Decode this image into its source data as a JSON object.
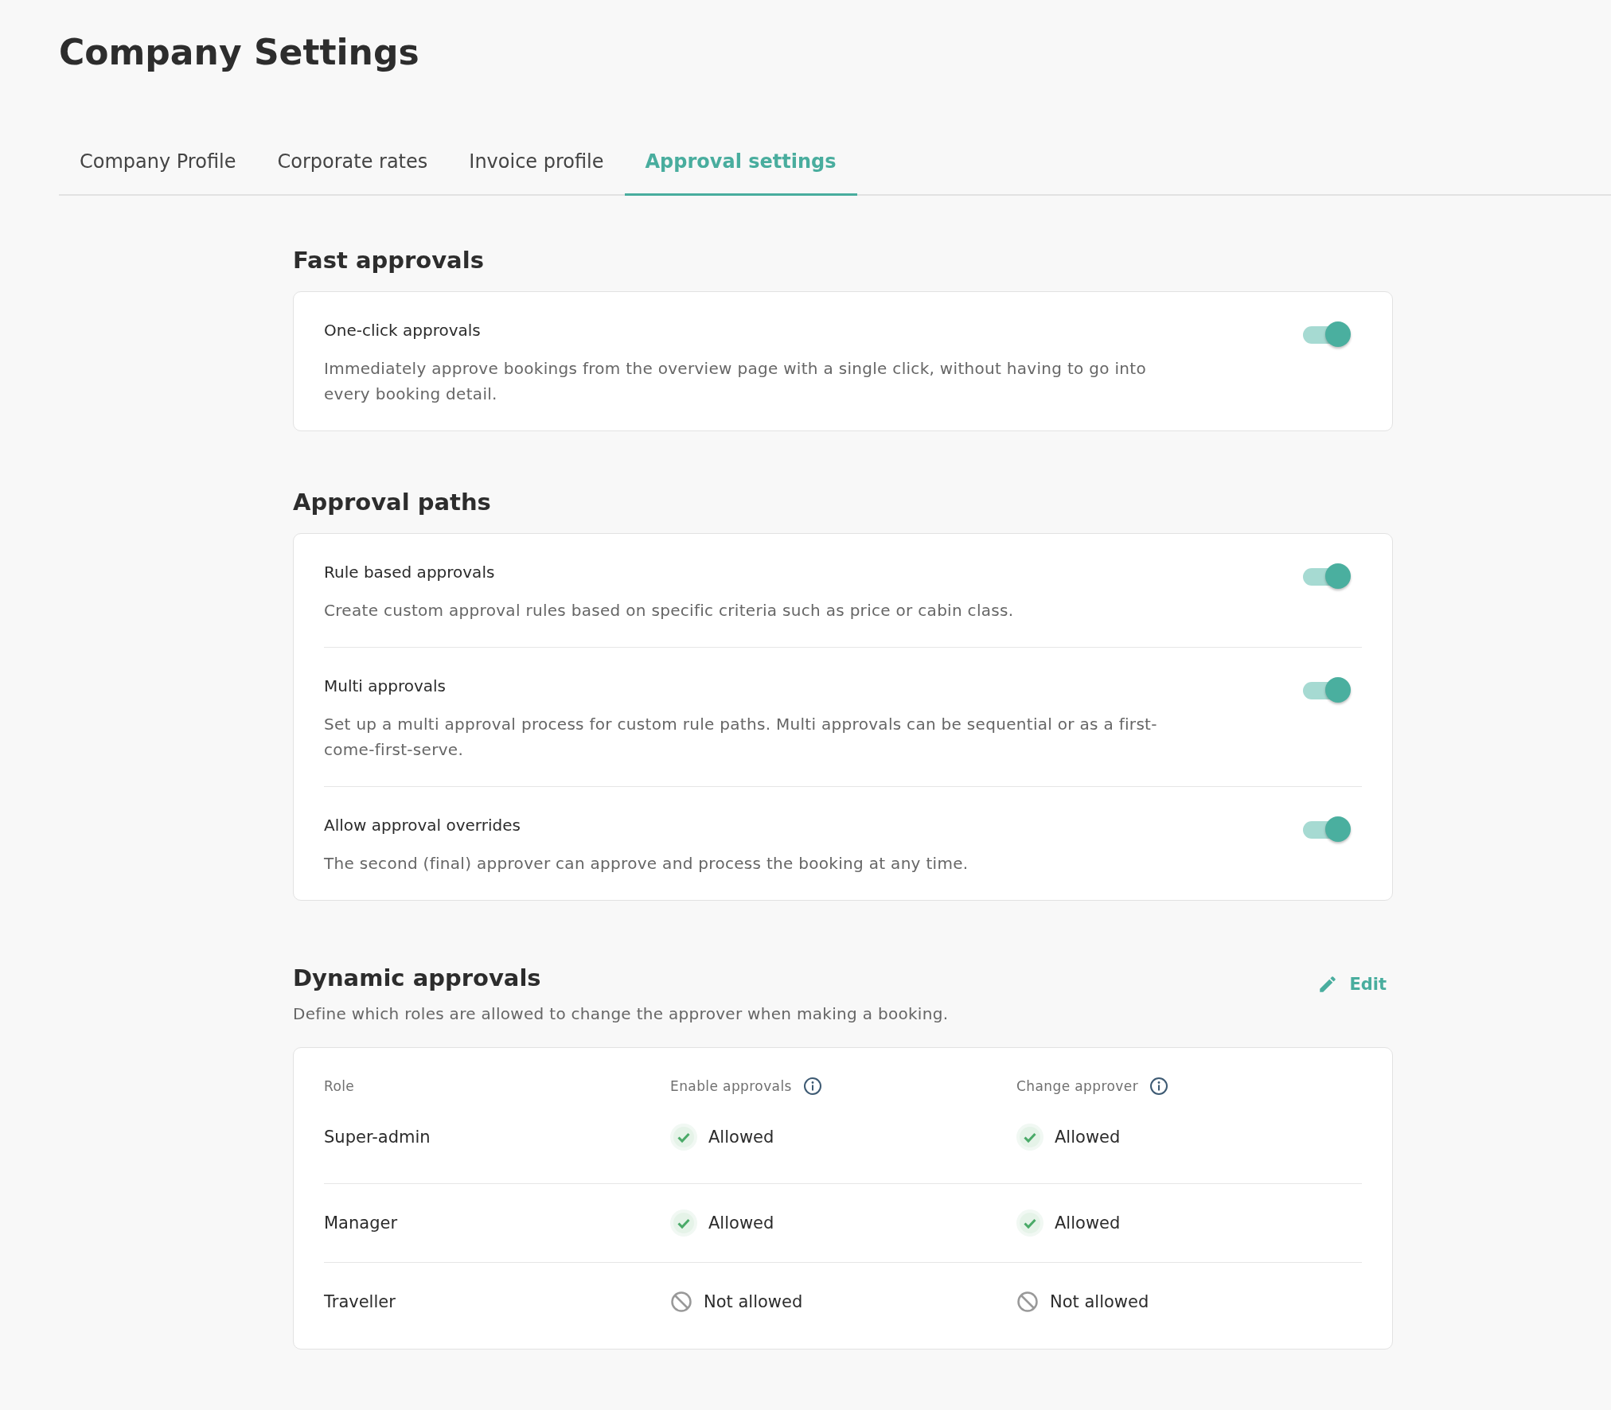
{
  "page_title": "Company Settings",
  "tabs": [
    {
      "label": "Company Profile",
      "selected": false
    },
    {
      "label": "Corporate rates",
      "selected": false
    },
    {
      "label": "Invoice profile",
      "selected": false
    },
    {
      "label": "Approval settings",
      "selected": true
    }
  ],
  "fast_approvals": {
    "heading": "Fast approvals",
    "settings": [
      {
        "title": "One-click approvals",
        "description": "Immediately approve bookings from the overview page with a single click, without having to go into every booking detail.",
        "on": true
      }
    ]
  },
  "approval_paths": {
    "heading": "Approval paths",
    "settings": [
      {
        "title": "Rule based approvals",
        "description": "Create custom approval rules based on specific criteria such as price or cabin class.",
        "on": true
      },
      {
        "title": "Multi approvals",
        "description": "Set up a multi approval process for custom rule paths. Multi approvals can be sequential or as a first-come-first-serve.",
        "on": true
      },
      {
        "title": "Allow approval overrides",
        "description": "The second (final) approver can approve and process the booking at any time.",
        "on": true
      }
    ]
  },
  "dynamic_approvals": {
    "heading": "Dynamic approvals",
    "edit_label": "Edit",
    "description": "Define which roles are allowed to change the approver when making a booking.",
    "columns": [
      {
        "label": "Role",
        "info": false
      },
      {
        "label": "Enable approvals",
        "info": true
      },
      {
        "label": "Change approver",
        "info": true
      }
    ],
    "rows": [
      {
        "cells": [
          {
            "kind": "role",
            "text": "Super-admin"
          },
          {
            "kind": "allowed",
            "text": "Allowed"
          },
          {
            "kind": "allowed",
            "text": "Allowed"
          }
        ]
      },
      {
        "cells": [
          {
            "kind": "role",
            "text": "Manager"
          },
          {
            "kind": "allowed",
            "text": "Allowed"
          },
          {
            "kind": "allowed",
            "text": "Allowed"
          }
        ]
      },
      {
        "cells": [
          {
            "kind": "role",
            "text": "Traveller"
          },
          {
            "kind": "denied",
            "text": "Not allowed"
          },
          {
            "kind": "denied",
            "text": "Not allowed"
          }
        ]
      }
    ]
  }
}
